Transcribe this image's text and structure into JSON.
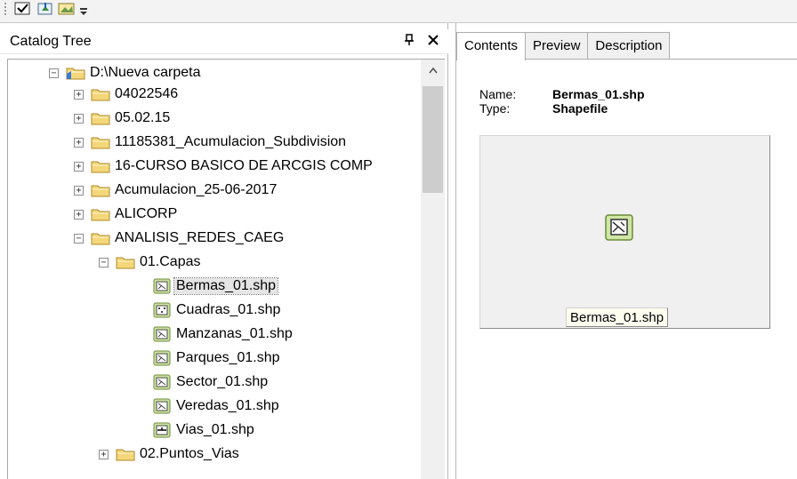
{
  "toolbar": {
    "icons": [
      "checkbox-icon",
      "add-data-icon",
      "catalog-image-icon",
      "toolbar-options-icon"
    ]
  },
  "catalog": {
    "title": "Catalog Tree",
    "pin_glyph": "ᵖ",
    "close_glyph": "✕"
  },
  "tree": {
    "root": "D:\\Nueva carpeta",
    "items": [
      {
        "label": "04022546"
      },
      {
        "label": "05.02.15"
      },
      {
        "label": "11185381_Acumulacion_Subdivision"
      },
      {
        "label": "16-CURSO BASICO DE ARCGIS COMP"
      },
      {
        "label": "Acumulacion_25-06-2017"
      },
      {
        "label": "ALICORP"
      },
      {
        "label": "ANALISIS_REDES_CAEG"
      },
      {
        "label": "01.Capas"
      },
      {
        "label": "Bermas_01.shp",
        "type": "polygon"
      },
      {
        "label": "Cuadras_01.shp",
        "type": "point"
      },
      {
        "label": "Manzanas_01.shp",
        "type": "polygon"
      },
      {
        "label": "Parques_01.shp",
        "type": "polygon"
      },
      {
        "label": "Sector_01.shp",
        "type": "polygon"
      },
      {
        "label": "Veredas_01.shp",
        "type": "polygon"
      },
      {
        "label": "Vias_01.shp",
        "type": "line"
      },
      {
        "label": "02.Puntos_Vias"
      }
    ],
    "selected": "Bermas_01.shp"
  },
  "tabs": [
    {
      "label": "Contents",
      "active": true
    },
    {
      "label": "Preview",
      "active": false
    },
    {
      "label": "Description",
      "active": false
    }
  ],
  "contents": {
    "name_key": "Name:",
    "name_value": "Bermas_01.shp",
    "type_key": "Type:",
    "type_value": "Shapefile",
    "thumbnail_caption": "Bermas_01.shp"
  },
  "colors": {
    "folder": "#f4d77a",
    "shp_icon_fill": "#cfe6a4",
    "selection": "#e5e5e5"
  }
}
